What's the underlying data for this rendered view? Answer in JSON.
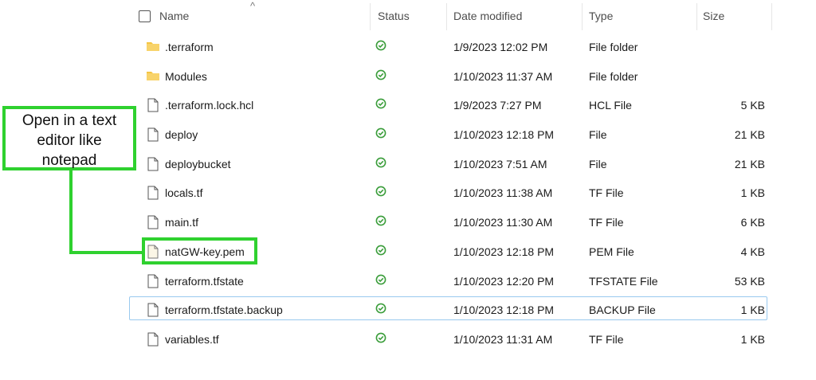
{
  "header": {
    "name": "Name",
    "status": "Status",
    "date": "Date modified",
    "type": "Type",
    "size": "Size"
  },
  "files": [
    {
      "name": ".terraform",
      "icon": "folder-icon",
      "date": "1/9/2023 12:02 PM",
      "type": "File folder",
      "size": ""
    },
    {
      "name": "Modules",
      "icon": "folder-icon",
      "date": "1/10/2023 11:37 AM",
      "type": "File folder",
      "size": ""
    },
    {
      "name": ".terraform.lock.hcl",
      "icon": "file-icon",
      "date": "1/9/2023 7:27 PM",
      "type": "HCL File",
      "size": "5 KB"
    },
    {
      "name": "deploy",
      "icon": "file-icon",
      "date": "1/10/2023 12:18 PM",
      "type": "File",
      "size": "21 KB"
    },
    {
      "name": "deploybucket",
      "icon": "file-icon",
      "date": "1/10/2023 7:51 AM",
      "type": "File",
      "size": "21 KB"
    },
    {
      "name": "locals.tf",
      "icon": "file-icon",
      "date": "1/10/2023 11:38 AM",
      "type": "TF File",
      "size": "1 KB"
    },
    {
      "name": "main.tf",
      "icon": "file-icon",
      "date": "1/10/2023 11:30 AM",
      "type": "TF File",
      "size": "6 KB"
    },
    {
      "name": "natGW-key.pem",
      "icon": "file-icon",
      "date": "1/10/2023 12:18 PM",
      "type": "PEM File",
      "size": "4 KB"
    },
    {
      "name": "terraform.tfstate",
      "icon": "file-icon",
      "date": "1/10/2023 12:20 PM",
      "type": "TFSTATE File",
      "size": "53 KB"
    },
    {
      "name": "terraform.tfstate.backup",
      "icon": "file-icon",
      "date": "1/10/2023 12:18 PM",
      "type": "BACKUP File",
      "size": "1 KB"
    },
    {
      "name": "variables.tf",
      "icon": "file-icon",
      "date": "1/10/2023 11:31 AM",
      "type": "TF File",
      "size": "1 KB"
    }
  ],
  "status_icon": "synced-check-icon",
  "colors": {
    "highlight": "#2fd12f",
    "status": "#3a9d3a",
    "folder": "#f5c542",
    "selection_border": "#99c9ef"
  },
  "callout": {
    "line1": "Open in a text",
    "line2": "editor like",
    "line3": "notepad"
  }
}
